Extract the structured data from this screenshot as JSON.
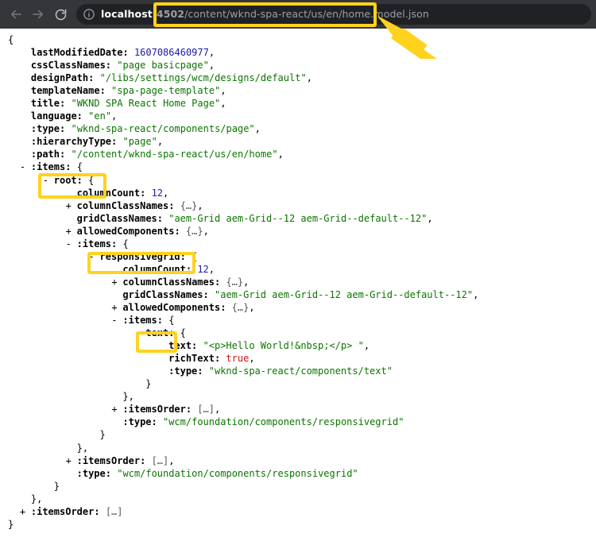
{
  "browser": {
    "back_icon": "arrow-left-icon",
    "forward_icon": "arrow-right-icon",
    "reload_icon": "reload-icon",
    "site_info_icon": "info-circle-icon",
    "url": {
      "host": "localhost",
      "port": ":4502",
      "path": "/content/wknd-spa-react/us/en/home.model.json",
      "full": "localhost:4502/content/wknd-spa-react/us/en/home.model.json"
    }
  },
  "annotations": {
    "highlight_color": "#ffd21e",
    "boxes": [
      {
        "name": "url-path-highlight",
        "target": "/content/wknd-spa-react/us/en/home.model.json"
      },
      {
        "name": "root-node-highlight",
        "target": "root:"
      },
      {
        "name": "responsivegrid-node-highlight",
        "target": "responsivegrid:"
      },
      {
        "name": "text-node-highlight",
        "target": "text:"
      }
    ],
    "arrow": {
      "name": "pointer-arrow",
      "points_to": "url-path-highlight"
    }
  },
  "json_viewer": {
    "lines": [
      {
        "indent": 0,
        "toggle": "",
        "text": "{"
      },
      {
        "indent": 2,
        "toggle": "",
        "key": "lastModifiedDate",
        "value": "1607086460977",
        "vtype": "num",
        "suffix": ","
      },
      {
        "indent": 2,
        "toggle": "",
        "key": "cssClassNames",
        "value": "\"page basicpage\"",
        "vtype": "str",
        "suffix": ","
      },
      {
        "indent": 2,
        "toggle": "",
        "key": "designPath",
        "value": "\"/libs/settings/wcm/designs/default\"",
        "vtype": "str",
        "suffix": ","
      },
      {
        "indent": 2,
        "toggle": "",
        "key": "templateName",
        "value": "\"spa-page-template\"",
        "vtype": "str",
        "suffix": ","
      },
      {
        "indent": 2,
        "toggle": "",
        "key": "title",
        "value": "\"WKND SPA React Home Page\"",
        "vtype": "str",
        "suffix": ","
      },
      {
        "indent": 2,
        "toggle": "",
        "key": "language",
        "value": "\"en\"",
        "vtype": "str",
        "suffix": ","
      },
      {
        "indent": 2,
        "toggle": "",
        "key": ":type",
        "value": "\"wknd-spa-react/components/page\"",
        "vtype": "str",
        "suffix": ","
      },
      {
        "indent": 2,
        "toggle": "",
        "key": ":hierarchyType",
        "value": "\"page\"",
        "vtype": "str",
        "suffix": ","
      },
      {
        "indent": 2,
        "toggle": "",
        "key": ":path",
        "value": "\"/content/wknd-spa-react/us/en/home\"",
        "vtype": "str",
        "suffix": ","
      },
      {
        "indent": 2,
        "toggle": "-",
        "key": ":items",
        "value": "{",
        "vtype": "punct",
        "suffix": ""
      },
      {
        "indent": 4,
        "toggle": "-",
        "key": "root",
        "value": "{",
        "vtype": "punct",
        "suffix": ""
      },
      {
        "indent": 6,
        "toggle": "",
        "key": "columnCount",
        "value": "12",
        "vtype": "num",
        "suffix": ","
      },
      {
        "indent": 6,
        "toggle": "+",
        "key": "columnClassNames",
        "value": "{…}",
        "vtype": "ell",
        "suffix": ","
      },
      {
        "indent": 6,
        "toggle": "",
        "key": "gridClassNames",
        "value": "\"aem-Grid aem-Grid--12 aem-Grid--default--12\"",
        "vtype": "str",
        "suffix": ","
      },
      {
        "indent": 6,
        "toggle": "+",
        "key": "allowedComponents",
        "value": "{…}",
        "vtype": "ell",
        "suffix": ","
      },
      {
        "indent": 6,
        "toggle": "-",
        "key": ":items",
        "value": "{",
        "vtype": "punct",
        "suffix": ""
      },
      {
        "indent": 8,
        "toggle": "-",
        "key": "responsivegrid",
        "value": "{",
        "vtype": "punct",
        "suffix": ""
      },
      {
        "indent": 10,
        "toggle": "",
        "key": "columnCount",
        "value": "12",
        "vtype": "num",
        "suffix": ","
      },
      {
        "indent": 10,
        "toggle": "+",
        "key": "columnClassNames",
        "value": "{…}",
        "vtype": "ell",
        "suffix": ","
      },
      {
        "indent": 10,
        "toggle": "",
        "key": "gridClassNames",
        "value": "\"aem-Grid aem-Grid--12 aem-Grid--default--12\"",
        "vtype": "str",
        "suffix": ","
      },
      {
        "indent": 10,
        "toggle": "+",
        "key": "allowedComponents",
        "value": "{…}",
        "vtype": "ell",
        "suffix": ","
      },
      {
        "indent": 10,
        "toggle": "-",
        "key": ":items",
        "value": "{",
        "vtype": "punct",
        "suffix": ""
      },
      {
        "indent": 12,
        "toggle": "-",
        "key": "text",
        "value": "{",
        "vtype": "punct",
        "suffix": ""
      },
      {
        "indent": 14,
        "toggle": "",
        "key": "text",
        "value": "\"<p>Hello World!&nbsp;</p> \"",
        "vtype": "str",
        "suffix": ","
      },
      {
        "indent": 14,
        "toggle": "",
        "key": "richText",
        "value": "true",
        "vtype": "bool",
        "suffix": ","
      },
      {
        "indent": 14,
        "toggle": "",
        "key": ":type",
        "value": "\"wknd-spa-react/components/text\"",
        "vtype": "str",
        "suffix": ""
      },
      {
        "indent": 12,
        "toggle": "",
        "text": "}"
      },
      {
        "indent": 10,
        "toggle": "",
        "text": "},"
      },
      {
        "indent": 10,
        "toggle": "+",
        "key": ":itemsOrder",
        "value": "[…]",
        "vtype": "ell",
        "suffix": ","
      },
      {
        "indent": 10,
        "toggle": "",
        "key": ":type",
        "value": "\"wcm/foundation/components/responsivegrid\"",
        "vtype": "str",
        "suffix": ""
      },
      {
        "indent": 8,
        "toggle": "",
        "text": "}"
      },
      {
        "indent": 6,
        "toggle": "",
        "text": "},"
      },
      {
        "indent": 6,
        "toggle": "+",
        "key": ":itemsOrder",
        "value": "[…]",
        "vtype": "ell",
        "suffix": ","
      },
      {
        "indent": 6,
        "toggle": "",
        "key": ":type",
        "value": "\"wcm/foundation/components/responsivegrid\"",
        "vtype": "str",
        "suffix": ""
      },
      {
        "indent": 4,
        "toggle": "",
        "text": "}"
      },
      {
        "indent": 2,
        "toggle": "",
        "text": "},"
      },
      {
        "indent": 2,
        "toggle": "+",
        "key": ":itemsOrder",
        "value": "[…]",
        "vtype": "ell",
        "suffix": ""
      },
      {
        "indent": 0,
        "toggle": "",
        "text": "}"
      }
    ]
  }
}
